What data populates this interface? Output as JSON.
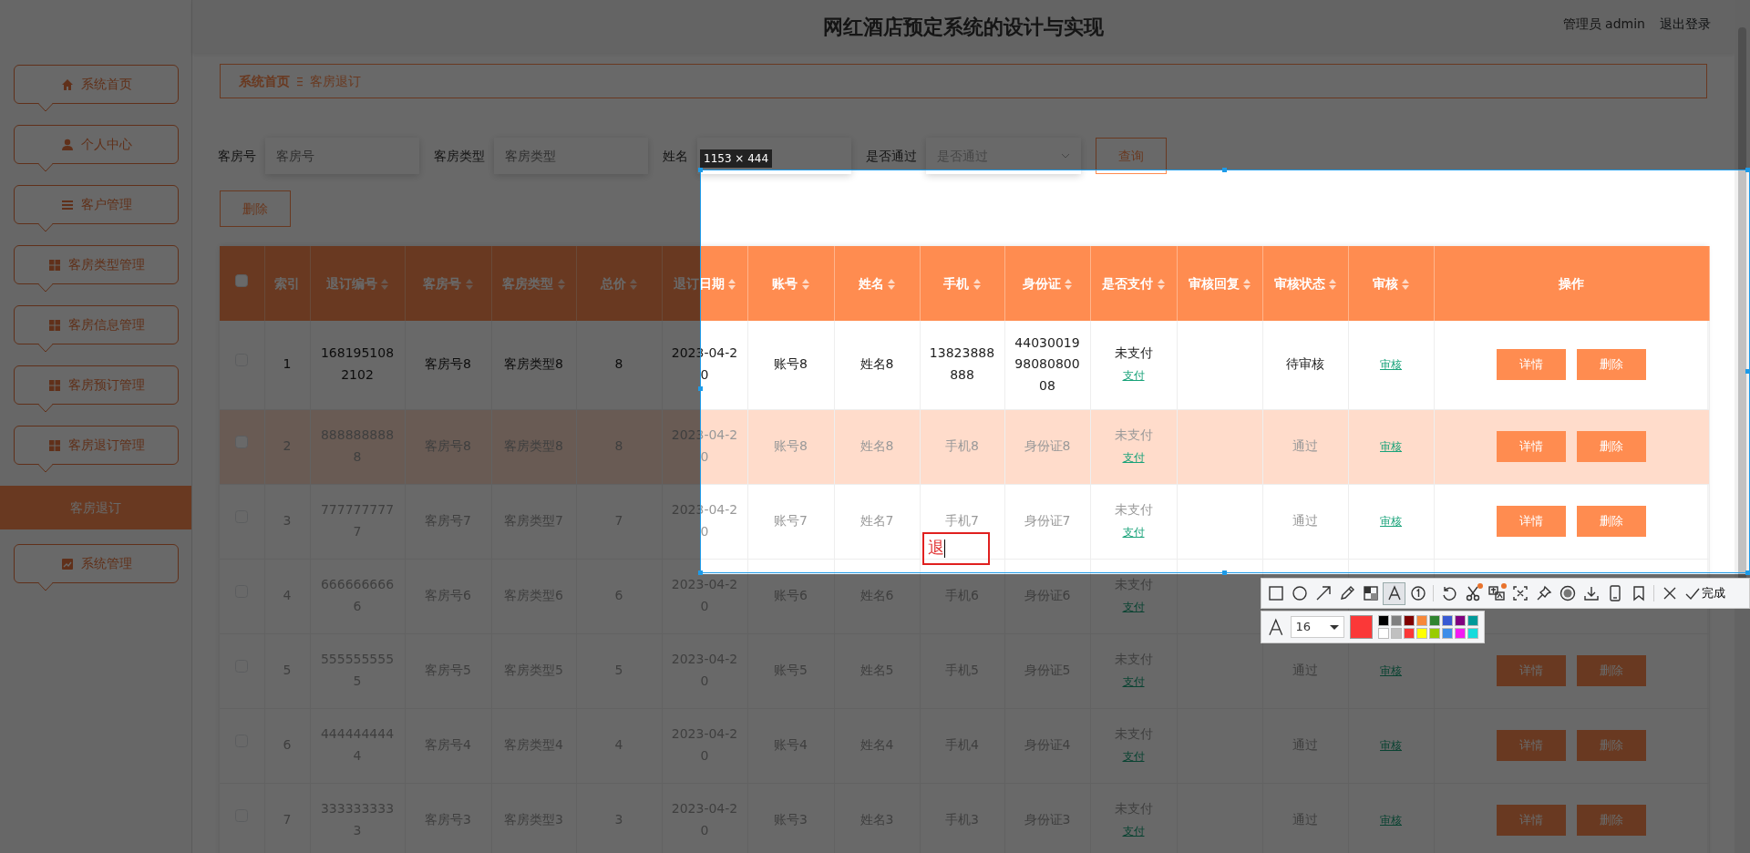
{
  "header": {
    "title": "网红酒店预定系统的设计与实现",
    "user": "管理员 admin",
    "logout": "退出登录"
  },
  "sidebar": {
    "items": [
      {
        "label": "系统首页",
        "kind": "home"
      },
      {
        "label": "个人中心",
        "kind": "user"
      },
      {
        "label": "客户管理",
        "kind": "list"
      },
      {
        "label": "客房类型管理",
        "kind": "grid"
      },
      {
        "label": "客房信息管理",
        "kind": "grid"
      },
      {
        "label": "客房预订管理",
        "kind": "grid"
      },
      {
        "label": "客房退订管理",
        "kind": "grid",
        "children": [
          {
            "label": "客房退订",
            "selected": true
          }
        ]
      },
      {
        "label": "系统管理",
        "kind": "chart"
      }
    ]
  },
  "breadcrumb": [
    {
      "label": "系统首页"
    },
    {
      "label": "客房退订"
    }
  ],
  "filters": [
    {
      "label": "客房号",
      "kind": "text",
      "placeholder": "客房号"
    },
    {
      "label": "客房类型",
      "kind": "text",
      "placeholder": "客房类型"
    },
    {
      "label": "姓名",
      "kind": "text"
    },
    {
      "label": "是否通过",
      "kind": "select",
      "placeholder": "是否通过"
    }
  ],
  "search_button": "查询",
  "delete_button": "删除",
  "table": {
    "all_checked": false,
    "columns": [
      {
        "label": "索引",
        "sortable": false
      },
      {
        "label": "退订编号",
        "sortable": true
      },
      {
        "label": "客房号",
        "sortable": true
      },
      {
        "label": "客房类型",
        "sortable": true
      },
      {
        "label": "总价",
        "sortable": true
      },
      {
        "label": "退订日期",
        "sortable": true
      },
      {
        "label": "账号",
        "sortable": true
      },
      {
        "label": "姓名",
        "sortable": true
      },
      {
        "label": "手机",
        "sortable": true
      },
      {
        "label": "身份证",
        "sortable": true
      },
      {
        "label": "是否支付",
        "sortable": true
      },
      {
        "label": "审核回复",
        "sortable": true
      },
      {
        "label": "审核状态",
        "sortable": true
      },
      {
        "label": "审核",
        "sortable": true
      },
      {
        "label": "操作",
        "sortable": false
      }
    ],
    "rows": [
      {
        "checked": false,
        "highlighted": false,
        "faded": false,
        "cells": [
          "1",
          "1681951082102",
          "客房号8",
          "客房类型8",
          "8",
          "2023-04-20",
          "账号8",
          "姓名8",
          "13823888888",
          "440300199808080008",
          "未支付"
        ],
        "pay_link": "支付",
        "review_status": "待审核",
        "review_link": "审核",
        "actions": [
          "详情",
          "删除"
        ]
      },
      {
        "checked": false,
        "highlighted": true,
        "faded": true,
        "cells": [
          "2",
          "8888888888",
          "客房号8",
          "客房类型8",
          "8",
          "2023-04-20",
          "账号8",
          "姓名8",
          "手机8",
          "身份证8",
          "未支付"
        ],
        "pay_link": "支付",
        "review_status": "通过",
        "review_link": "审核",
        "actions": [
          "详情",
          "删除"
        ]
      },
      {
        "checked": false,
        "highlighted": false,
        "faded": true,
        "cells": [
          "3",
          "7777777777",
          "客房号7",
          "客房类型7",
          "7",
          "2023-04-20",
          "账号7",
          "姓名7",
          "手机7",
          "身份证7",
          "未支付"
        ],
        "pay_link": "支付",
        "review_status": "通过",
        "review_link": "审核",
        "actions": [
          "详情",
          "删除"
        ],
        "phone_annotation": "退"
      },
      {
        "checked": false,
        "highlighted": false,
        "faded": true,
        "cells": [
          "4",
          "6666666666",
          "客房号6",
          "客房类型6",
          "6",
          "2023-04-20",
          "账号6",
          "姓名6",
          "手机6",
          "身份证6",
          "未支付"
        ],
        "pay_link": "支付"
      },
      {
        "checked": false,
        "highlighted": false,
        "faded": true,
        "cells": [
          "5",
          "5555555555",
          "客房号5",
          "客房类型5",
          "5",
          "2023-04-20",
          "账号5",
          "姓名5",
          "手机5",
          "身份证5",
          "未支付"
        ],
        "pay_link": "支付",
        "review_status": "通过",
        "review_link": "审核",
        "actions": [
          "详情",
          "删除"
        ]
      },
      {
        "checked": false,
        "highlighted": false,
        "faded": true,
        "cells": [
          "6",
          "4444444444",
          "客房号4",
          "客房类型4",
          "4",
          "2023-04-20",
          "账号4",
          "姓名4",
          "手机4",
          "身份证4",
          "未支付"
        ],
        "pay_link": "支付",
        "review_status": "通过",
        "review_link": "审核",
        "actions": [
          "详情",
          "删除"
        ]
      },
      {
        "checked": false,
        "highlighted": false,
        "faded": true,
        "cells": [
          "7",
          "3333333333",
          "客房号3",
          "客房类型3",
          "3",
          "2023-04-20",
          "账号3",
          "姓名3",
          "手机3",
          "身份证3",
          "未支付"
        ],
        "pay_link": "支付",
        "review_status": "通过",
        "review_link": "审核",
        "actions": [
          "详情",
          "删除"
        ]
      }
    ]
  },
  "capture": {
    "size_label": "1153 × 444",
    "tools": [
      {
        "kind": "rectangle",
        "selected": false,
        "badge": false
      },
      {
        "kind": "ellipse",
        "selected": false,
        "badge": false
      },
      {
        "kind": "arrow",
        "selected": false,
        "badge": false
      },
      {
        "kind": "pencil",
        "selected": false,
        "badge": false
      },
      {
        "kind": "mosaic",
        "selected": false,
        "badge": false
      },
      {
        "kind": "text",
        "selected": true,
        "badge": false
      },
      {
        "kind": "number",
        "selected": false,
        "badge": false
      },
      {
        "kind": "undo",
        "selected": false,
        "badge": false
      },
      {
        "kind": "scissors",
        "selected": false,
        "badge": true
      },
      {
        "kind": "translate",
        "selected": false,
        "badge": true
      },
      {
        "kind": "ocr",
        "selected": false,
        "badge": false
      },
      {
        "kind": "pin",
        "selected": false,
        "badge": false
      },
      {
        "kind": "record",
        "selected": false,
        "badge": false
      },
      {
        "kind": "download",
        "selected": false,
        "badge": false
      },
      {
        "kind": "phone",
        "selected": false,
        "badge": false
      },
      {
        "kind": "bookmark",
        "selected": false,
        "badge": false
      },
      {
        "kind": "close",
        "selected": false,
        "badge": false
      }
    ],
    "done_label": "完成",
    "font_size": "16",
    "current_swatch": {
      "color": "#fb3838"
    },
    "palette": [
      {
        "color": "#000000"
      },
      {
        "color": "#808080"
      },
      {
        "color": "#800000"
      },
      {
        "color": "#f7883a"
      },
      {
        "color": "#308430"
      },
      {
        "color": "#385ad3"
      },
      {
        "color": "#800080"
      },
      {
        "color": "#009999"
      },
      {
        "color": "#ffffff"
      },
      {
        "color": "#c0c0c0"
      },
      {
        "color": "#fb3838"
      },
      {
        "color": "#ffff00"
      },
      {
        "color": "#99cc00"
      },
      {
        "color": "#3d8ee9"
      },
      {
        "color": "#f31bf3"
      },
      {
        "color": "#16dcdc"
      }
    ]
  }
}
